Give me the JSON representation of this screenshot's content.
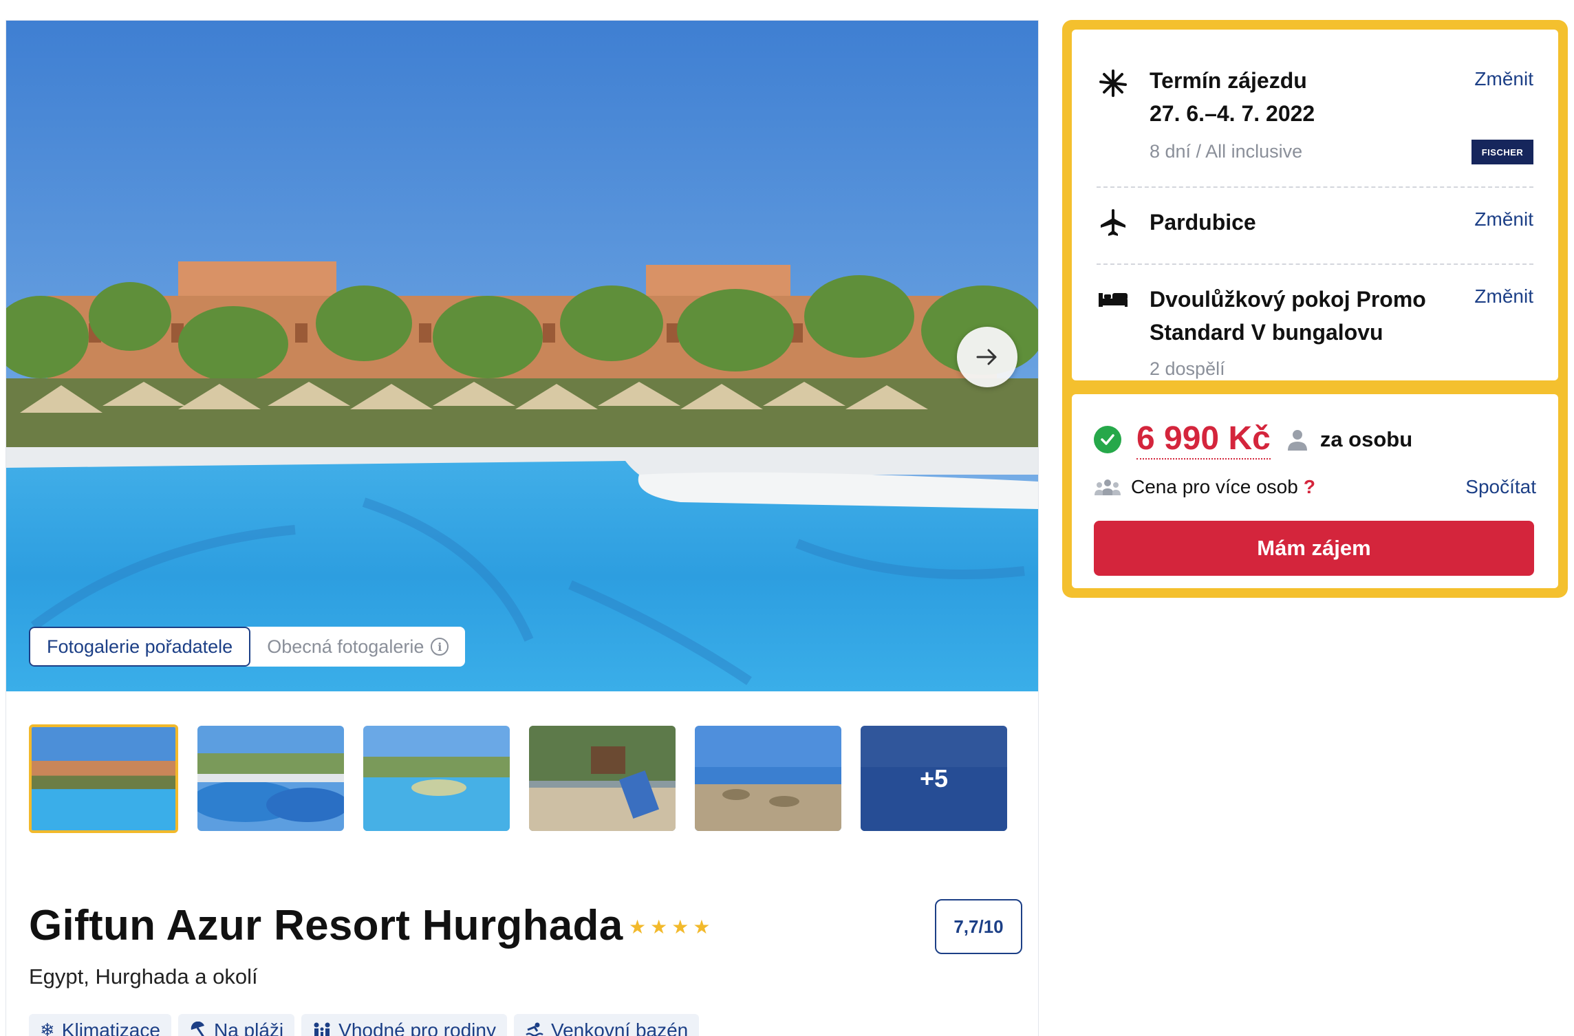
{
  "gallery": {
    "tabs": [
      {
        "label": "Fotogalerie pořadatele",
        "active": true
      },
      {
        "label": "Obecná fotogalerie",
        "active": false
      }
    ],
    "thumbnails": [
      {
        "scene": "pool-resort",
        "selected": true
      },
      {
        "scene": "pool-palms",
        "selected": false
      },
      {
        "scene": "pool-island",
        "selected": false
      },
      {
        "scene": "playground",
        "selected": false
      },
      {
        "scene": "beach",
        "selected": false
      },
      {
        "scene": "sea",
        "selected": false,
        "overlay": "+5"
      }
    ],
    "next_icon": "arrow-right-icon"
  },
  "hotel": {
    "name": "Giftun Azur Resort Hurghada",
    "stars": 4,
    "rating": "7,7/10",
    "location": "Egypt, Hurghada a okolí",
    "amenities": [
      {
        "label": "Klimatizace",
        "icon": "snowflake-icon"
      },
      {
        "label": "Na pláži",
        "icon": "beach-umbrella-icon"
      },
      {
        "label": "Vhodné pro rodiny",
        "icon": "family-icon"
      },
      {
        "label": "Venkovní bazén",
        "icon": "pool-icon"
      }
    ]
  },
  "booking": {
    "term": {
      "title": "Termín zájezdu",
      "dates": "27. 6.–4. 7. 2022",
      "detail": "8 dní / All inclusive",
      "change": "Změnit",
      "provider": "FISCHER"
    },
    "departure": {
      "city": "Pardubice",
      "change": "Změnit"
    },
    "room": {
      "line1": "Dvoulůžkový pokoj Promo",
      "line2": "Standard V bungalovu",
      "guests": "2 dospělí",
      "change": "Změnit"
    },
    "price": {
      "amount": "6 990 Kč",
      "per": "za osobu",
      "more_people": "Cena pro více osob",
      "question": "?",
      "calculate": "Spočítat",
      "cta": "Mám zájem"
    }
  },
  "colors": {
    "brand_blue": "#1c3f86",
    "price_red": "#d4253c",
    "highlight_yellow": "#f4c02e",
    "success_green": "#26a84a"
  }
}
